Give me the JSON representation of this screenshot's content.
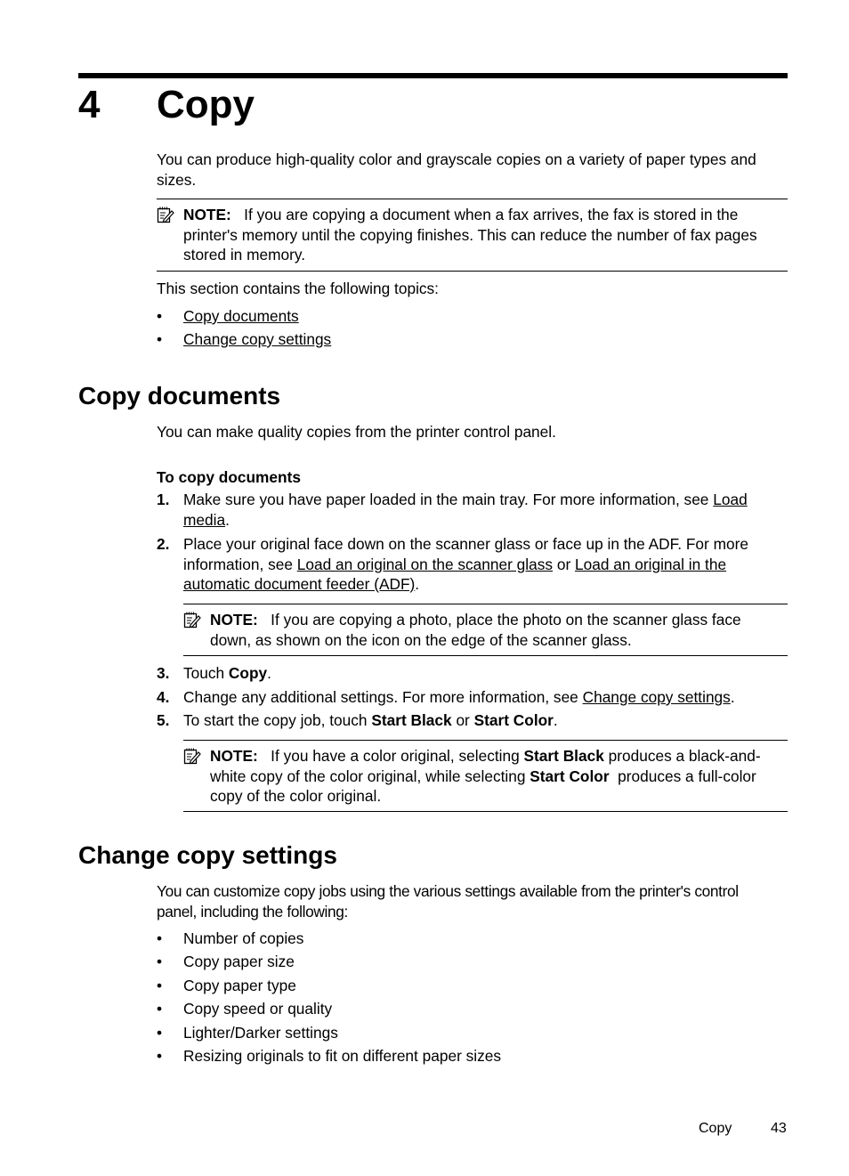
{
  "chapter": {
    "number": "4",
    "title": "Copy",
    "intro_line1": "You can produce high-quality color and grayscale copies on a variety of paper types and",
    "intro_line2": "sizes.",
    "note1": {
      "icon": "note-pencil-icon",
      "label": "NOTE:",
      "line1": "If you are copying a document when a fax arrives, the fax is stored in the",
      "line2": "printer's memory until the copying finishes. This can reduce the number of fax pages",
      "line3": "stored in memory."
    },
    "topics_intro": "This section contains the following topics:",
    "topics": [
      {
        "label": "Copy documents"
      },
      {
        "label": "Change copy settings"
      }
    ]
  },
  "copy_documents": {
    "heading": "Copy documents",
    "intro": "You can make quality copies from the printer control panel.",
    "procedure_title": "To copy documents",
    "steps": [
      {
        "num": "1.",
        "line1_text": "Make sure you have paper loaded in the main tray. For more information, see ",
        "link1a": "Load",
        "link1b": "media",
        "line2_tail": "."
      },
      {
        "num": "2.",
        "line1": "Place your original face down on the scanner glass or face up in the ADF. For more",
        "line2_text": "information, see ",
        "link_a": "Load an original on the scanner glass",
        "mid": " or ",
        "link_b1": "Load an original in the",
        "link_b2": "automatic document feeder (ADF)",
        "tail": "."
      },
      {
        "num": "3.",
        "text": "Touch ",
        "bold": "Copy",
        "tail": "."
      },
      {
        "num": "4.",
        "text": "Change any additional settings. For more information, see ",
        "link": "Change copy settings",
        "tail": "."
      },
      {
        "num": "5.",
        "text": "To start the copy job, touch ",
        "bold1": "Start Black",
        "mid": " or ",
        "bold2": "Start Color",
        "tail": "."
      }
    ],
    "note2": {
      "label": "NOTE:",
      "line1": "If you are copying a photo, place the photo on the scanner glass face",
      "line2": "down, as shown on the icon on the edge of the scanner glass."
    },
    "note3": {
      "label": "NOTE:",
      "l1_text": "If you have a color original, selecting ",
      "l1_bold": "Start Black",
      "l1_tail": " produces a black-and-",
      "l2_text": "white copy of the color original, while selecting ",
      "l2_bold": "Start Color",
      "l2_tail": "  produces a full-color",
      "line3": "copy of the color original."
    }
  },
  "change_copy_settings": {
    "heading": "Change copy settings",
    "intro_line1": "You can customize copy jobs using the various settings available from the printer's control",
    "intro_line2": "panel, including the following:",
    "items": [
      "Number of copies",
      "Copy paper size",
      "Copy paper type",
      "Copy speed or quality",
      "Lighter/Darker settings",
      "Resizing originals to fit on different paper sizes"
    ]
  },
  "footer": {
    "section": "Copy",
    "page": "43"
  },
  "bullet_char": "•"
}
